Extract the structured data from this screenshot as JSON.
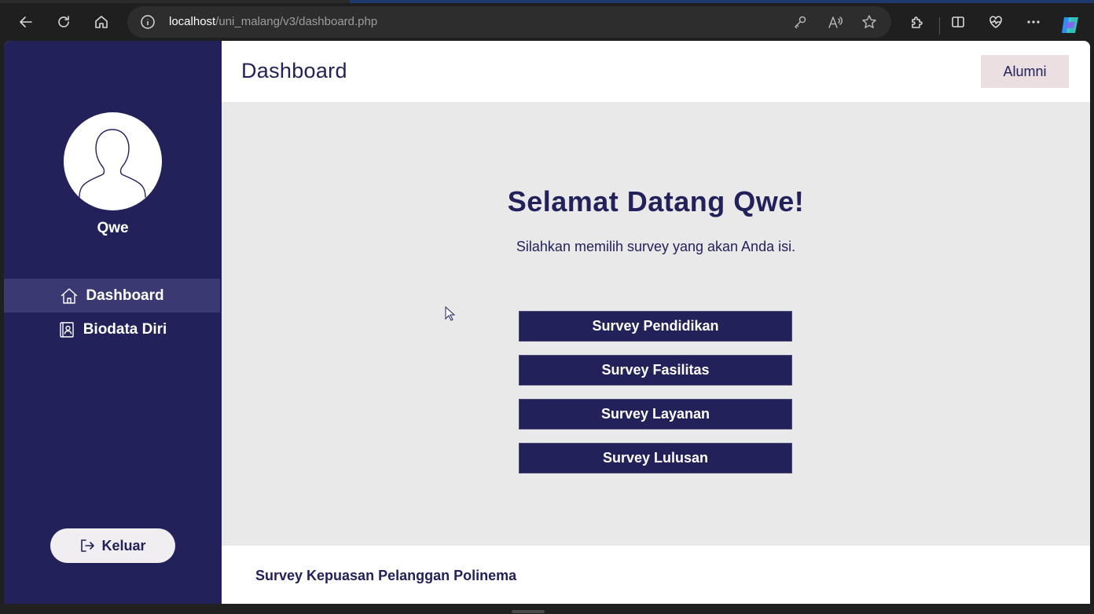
{
  "browser": {
    "url_host": "localhost",
    "url_path": "/uni_malang/v3/dashboard.php"
  },
  "sidebar": {
    "username": "Qwe",
    "nav": [
      {
        "label": "Dashboard",
        "icon": "home-icon",
        "active": true
      },
      {
        "label": "Biodata Diri",
        "icon": "contact-book-icon",
        "active": false
      }
    ],
    "logout_label": "Keluar"
  },
  "header": {
    "title": "Dashboard",
    "role": "Alumni"
  },
  "main": {
    "welcome": "Selamat Datang Qwe!",
    "subtitle": "Silahkan memilih survey yang akan Anda isi.",
    "surveys": [
      "Survey Pendidikan",
      "Survey Fasilitas",
      "Survey Layanan",
      "Survey Lulusan"
    ]
  },
  "footer": {
    "text": "Survey Kepuasan Pelanggan Polinema"
  },
  "colors": {
    "primary": "#22215a",
    "sidebar_active": "#3a3971",
    "content_bg": "#e9e9e9",
    "badge_bg": "#ecdfe2"
  }
}
